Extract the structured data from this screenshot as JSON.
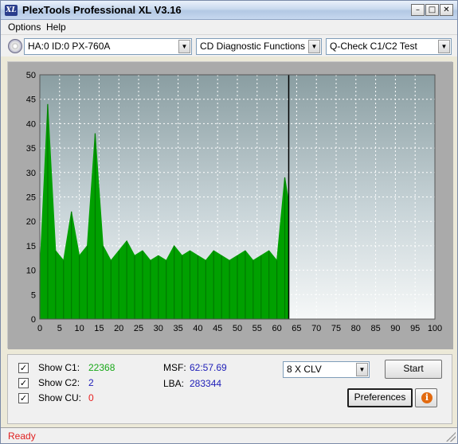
{
  "window": {
    "title": "PlexTools Professional XL V3.16",
    "icon_text": "XL",
    "controls": [
      "minimize",
      "maximize",
      "close"
    ]
  },
  "menu": {
    "items": [
      "Options",
      "Help"
    ]
  },
  "toolbar": {
    "drive": "HA:0 ID:0  PX-760A",
    "function": "CD Diagnostic Functions",
    "test": "Q-Check C1/C2 Test"
  },
  "chart_data": {
    "type": "bar",
    "title": "",
    "xlabel": "",
    "ylabel": "",
    "xlim": [
      0,
      100
    ],
    "ylim": [
      0,
      50
    ],
    "x_ticks": [
      "0",
      "5",
      "10",
      "15",
      "20",
      "25",
      "30",
      "35",
      "40",
      "45",
      "50",
      "55",
      "60",
      "65",
      "70",
      "75",
      "80",
      "85",
      "90",
      "95",
      "100"
    ],
    "y_ticks": [
      "0",
      "5",
      "10",
      "15",
      "20",
      "25",
      "30",
      "35",
      "40",
      "45",
      "50"
    ],
    "cursor_x": 63,
    "grid": true,
    "series": [
      {
        "color": "#00a000",
        "x": [
          0,
          2,
          4,
          6,
          8,
          10,
          12,
          14,
          16,
          18,
          20,
          22,
          24,
          26,
          28,
          30,
          32,
          34,
          36,
          38,
          40,
          42,
          44,
          46,
          48,
          50,
          52,
          54,
          56,
          58,
          60,
          62,
          63
        ],
        "values": [
          10,
          44,
          14,
          12,
          22,
          13,
          15,
          38,
          15,
          12,
          14,
          16,
          13,
          14,
          12,
          13,
          12,
          15,
          13,
          14,
          13,
          12,
          14,
          13,
          12,
          13,
          14,
          12,
          13,
          14,
          12,
          29,
          24
        ]
      }
    ]
  },
  "bottom": {
    "show_c1": {
      "label": "Show C1:",
      "value": "22368",
      "checked": true
    },
    "show_c2": {
      "label": "Show C2:",
      "value": "2",
      "checked": true
    },
    "show_cu": {
      "label": "Show CU:",
      "value": "0",
      "checked": true
    },
    "msf": {
      "label": "MSF:",
      "value": "62:57.69"
    },
    "lba": {
      "label": "LBA:",
      "value": "283344"
    },
    "speed": "8 X CLV",
    "start_label": "Start",
    "preferences_label": "Preferences",
    "info_glyph": "i"
  },
  "status": {
    "text": "Ready"
  },
  "colors": {
    "c1": "#00a000",
    "c2": "#2020b8",
    "cu": "#e82020"
  }
}
